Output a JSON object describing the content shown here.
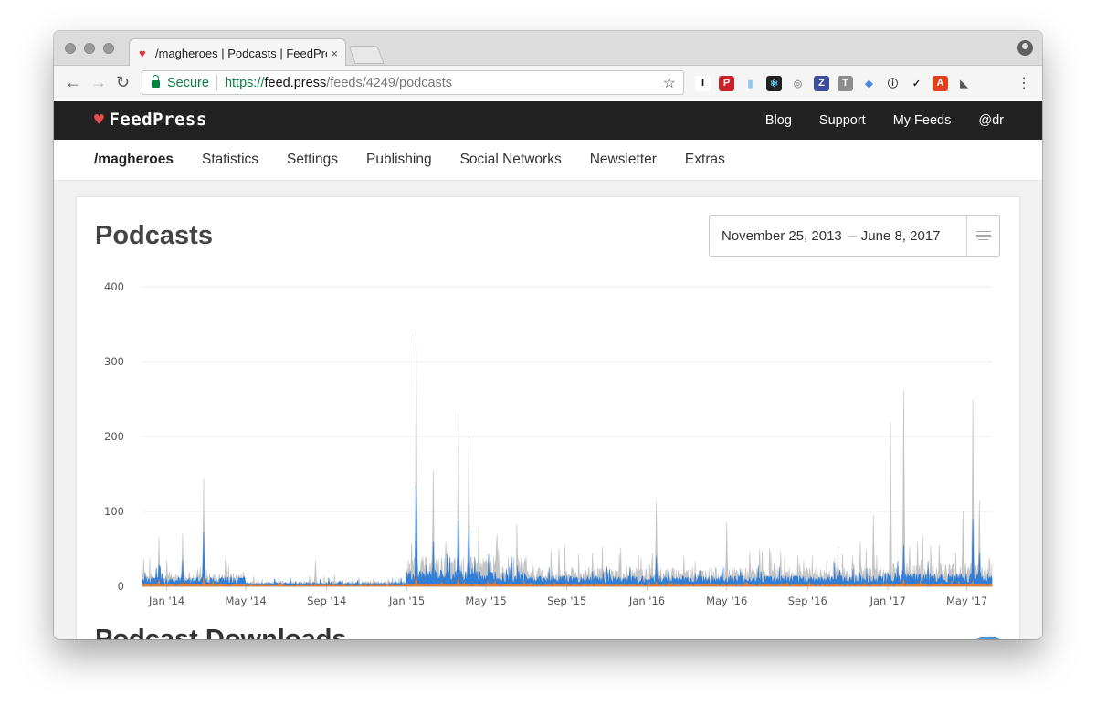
{
  "browser": {
    "tab_title": "/magheroes | Podcasts | FeedPress",
    "tab_close": "×",
    "secure_label": "Secure",
    "url_scheme": "https://",
    "url_host": "feed.press",
    "url_path": "/feeds/4249/podcasts",
    "extensions": [
      {
        "icon": "instapaper-icon",
        "glyph": "I",
        "color": "#111111",
        "bg": "#ffffff"
      },
      {
        "icon": "pinterest-icon",
        "glyph": "P",
        "color": "#ffffff",
        "bg": "#cb2027"
      },
      {
        "icon": "popsicle-icon",
        "glyph": "▮",
        "color": "#8ec8f2",
        "bg": "#f5f5f5"
      },
      {
        "icon": "react-icon",
        "glyph": "⚛",
        "color": "#61dafb",
        "bg": "#222222"
      },
      {
        "icon": "circle-icon",
        "glyph": "◎",
        "color": "#9a9a9a",
        "bg": "#f5f5f5"
      },
      {
        "icon": "zotero-icon",
        "glyph": "Z",
        "color": "#ffffff",
        "bg": "#3d4c9c"
      },
      {
        "icon": "text-icon",
        "glyph": "T",
        "color": "#ffffff",
        "bg": "#8c8c8c"
      },
      {
        "icon": "tag-icon",
        "glyph": "◈",
        "color": "#3a7bd5",
        "bg": "#f5f5f5"
      },
      {
        "icon": "info-icon",
        "glyph": "ⓘ",
        "color": "#222222",
        "bg": "#f5f5f5"
      },
      {
        "icon": "check-circle-icon",
        "glyph": "✓",
        "color": "#222222",
        "bg": "#f5f5f5"
      },
      {
        "icon": "acrobat-icon",
        "glyph": "A",
        "color": "#ffffff",
        "bg": "#e2401b"
      },
      {
        "icon": "tag-dark-icon",
        "glyph": "◣",
        "color": "#555555",
        "bg": "#f5f5f5"
      }
    ]
  },
  "app": {
    "brand": "FeedPress",
    "topnav": [
      "Blog",
      "Support",
      "My Feeds",
      "@dr"
    ],
    "subnav": [
      "/magheroes",
      "Statistics",
      "Settings",
      "Publishing",
      "Social Networks",
      "Newsletter",
      "Extras"
    ],
    "subnav_active": "/magheroes",
    "page_title": "Podcasts",
    "date_start": "November 25, 2013",
    "date_end": "June 8, 2017",
    "section_title": "Podcast Downloads",
    "colors": {
      "accent": "#2a7bd8",
      "secondary": "#f07f2a",
      "total": "#c4c4c4",
      "nav_bg": "#222222"
    }
  },
  "chart_data": {
    "type": "area",
    "ylim": [
      0,
      400
    ],
    "yticks": [
      0,
      100,
      200,
      300,
      400
    ],
    "xticks": [
      "Jan '14",
      "May '14",
      "Sep '14",
      "Jan '15",
      "May '15",
      "Sep '15",
      "Jan '16",
      "May '16",
      "Sep '16",
      "Jan '17",
      "May '17"
    ],
    "x_start": "2013-11-25",
    "x_end": "2017-06-08",
    "grid": true,
    "series": [
      {
        "name": "",
        "color": "#c4c4c4",
        "points": [
          [
            "2013-11-27",
            36
          ],
          [
            "2013-12-10",
            12
          ],
          [
            "2013-12-20",
            65
          ],
          [
            "2014-01-05",
            20
          ],
          [
            "2014-01-25",
            70
          ],
          [
            "2014-02-10",
            15
          ],
          [
            "2014-02-26",
            145
          ],
          [
            "2014-03-15",
            10
          ],
          [
            "2014-04-20",
            14
          ],
          [
            "2014-06-20",
            8
          ],
          [
            "2014-08-15",
            35
          ],
          [
            "2014-10-20",
            5
          ],
          [
            "2014-12-10",
            12
          ],
          [
            "2015-01-05",
            30
          ],
          [
            "2015-01-15",
            340
          ],
          [
            "2015-01-25",
            40
          ],
          [
            "2015-02-10",
            155
          ],
          [
            "2015-03-01",
            60
          ],
          [
            "2015-03-20",
            232
          ],
          [
            "2015-04-05",
            200
          ],
          [
            "2015-04-20",
            80
          ],
          [
            "2015-05-20",
            50
          ],
          [
            "2015-07-01",
            40
          ],
          [
            "2015-08-20",
            50
          ],
          [
            "2015-10-10",
            45
          ],
          [
            "2015-12-01",
            30
          ],
          [
            "2016-01-15",
            113
          ],
          [
            "2016-03-10",
            25
          ],
          [
            "2016-05-01",
            85
          ],
          [
            "2016-06-20",
            50
          ],
          [
            "2016-08-20",
            30
          ],
          [
            "2016-10-20",
            20
          ],
          [
            "2016-11-20",
            60
          ],
          [
            "2016-12-10",
            95
          ],
          [
            "2017-01-05",
            220
          ],
          [
            "2017-01-25",
            262
          ],
          [
            "2017-02-15",
            60
          ],
          [
            "2017-03-20",
            55
          ],
          [
            "2017-04-25",
            100
          ],
          [
            "2017-05-10",
            250
          ],
          [
            "2017-05-20",
            115
          ],
          [
            "2017-06-05",
            30
          ]
        ]
      },
      {
        "name": "",
        "color": "#2a7bd8",
        "points": [
          [
            "2013-12-20",
            28
          ],
          [
            "2014-01-25",
            35
          ],
          [
            "2014-02-26",
            73
          ],
          [
            "2015-01-15",
            135
          ],
          [
            "2015-02-10",
            60
          ],
          [
            "2015-03-20",
            88
          ],
          [
            "2015-04-05",
            75
          ],
          [
            "2016-01-15",
            40
          ],
          [
            "2017-01-25",
            55
          ],
          [
            "2017-05-10",
            90
          ],
          [
            "2017-05-20",
            45
          ]
        ]
      },
      {
        "name": "",
        "color": "#f07f2a",
        "points": [
          [
            "2013-12-20",
            10
          ],
          [
            "2014-02-26",
            12
          ],
          [
            "2015-01-15",
            15
          ],
          [
            "2015-03-20",
            12
          ],
          [
            "2016-01-15",
            6
          ],
          [
            "2017-01-25",
            10
          ],
          [
            "2017-05-10",
            8
          ]
        ]
      }
    ]
  }
}
